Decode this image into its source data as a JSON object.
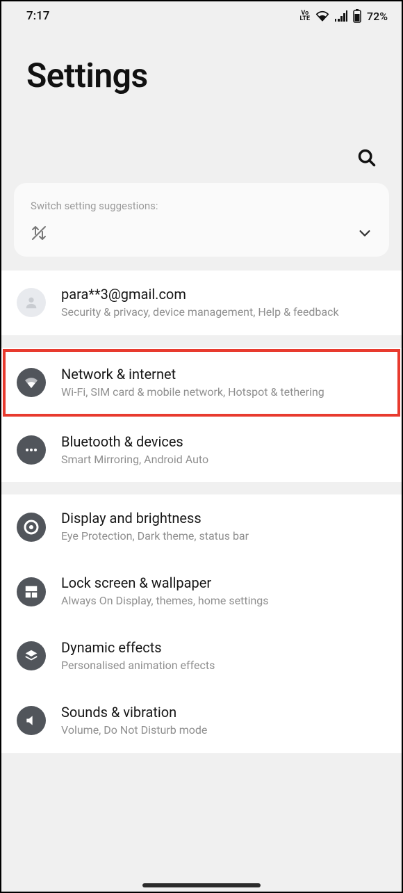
{
  "status": {
    "time": "7:17",
    "volte": "VoLTE",
    "battery_pct": "72%"
  },
  "header": {
    "title": "Settings"
  },
  "suggestions": {
    "label": "Switch setting suggestions:"
  },
  "account": {
    "email": "para**3@gmail.com",
    "sub": "Security & privacy, device management, Help & feedback"
  },
  "groups": [
    {
      "items": [
        {
          "key": "network",
          "title": "Network & internet",
          "sub": "Wi-Fi, SIM card & mobile network, Hotspot & tethering",
          "highlight": true
        },
        {
          "key": "bluetooth",
          "title": "Bluetooth & devices",
          "sub": "Smart Mirroring, Android Auto"
        }
      ]
    },
    {
      "items": [
        {
          "key": "display",
          "title": "Display and brightness",
          "sub": "Eye Protection, Dark theme, status bar"
        },
        {
          "key": "lockscreen",
          "title": "Lock screen & wallpaper",
          "sub": "Always On Display, themes, home settings"
        },
        {
          "key": "dynamic",
          "title": "Dynamic effects",
          "sub": "Personalised animation effects"
        },
        {
          "key": "sound",
          "title": "Sounds & vibration",
          "sub": "Volume, Do Not Disturb mode"
        }
      ]
    }
  ]
}
